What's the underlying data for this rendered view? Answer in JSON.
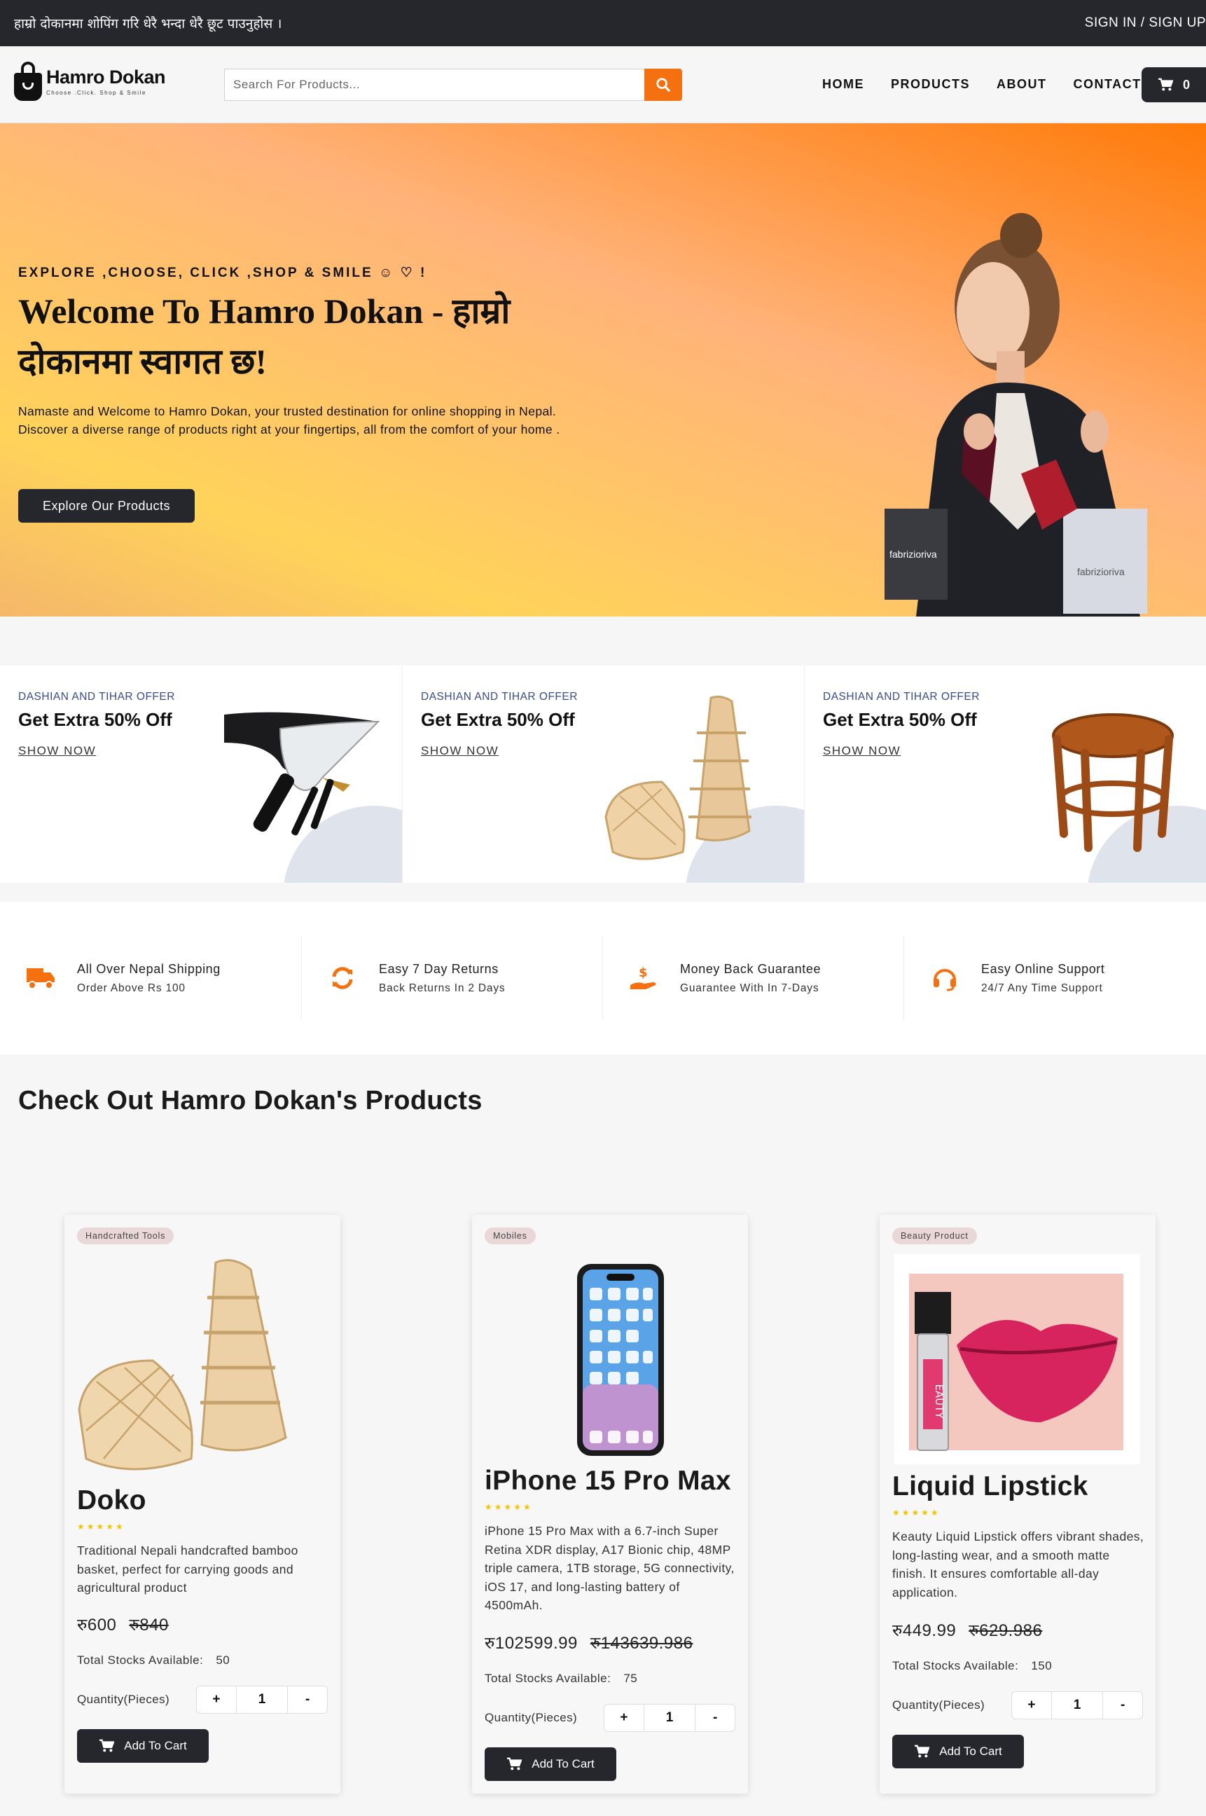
{
  "topbar": {
    "announcement": "हाम्रो दोकानमा शोपिंग गरि धेरै भन्दा धेरै छूट पाउनुहोस ।",
    "auth": "SIGN IN / SIGN UP"
  },
  "logo": {
    "brand": "Hamro Dokan",
    "tagline": "Choose .Click. Shop & Smile"
  },
  "search": {
    "placeholder": "Search For Products..."
  },
  "menu": {
    "home": "HOME",
    "products": "PRODUCTS",
    "about": "ABOUT",
    "contact": "CONTACT"
  },
  "cart": {
    "count": "0"
  },
  "hero": {
    "kicker": "EXPLORE ,CHOOSE, CLICK ,SHOP & SMILE ☺ ♡ !",
    "title": "Welcome To Hamro Dokan - हाम्रो दोकानमा स्वागत छ!",
    "lead": "Namaste and Welcome to Hamro Dokan, your trusted destination for online shopping in Nepal. Discover a diverse range of products right at your fingertips, all from the comfort of your home .",
    "cta": "Explore Our Products",
    "bag_brand": "fabrizioriva"
  },
  "offers": [
    {
      "category": "DASHIAN AND TIHAR OFFER",
      "title": "Get Extra 50% Off",
      "link": "SHOW NOW"
    },
    {
      "category": "DASHIAN AND TIHAR OFFER",
      "title": "Get Extra 50% Off",
      "link": "SHOW NOW"
    },
    {
      "category": "DASHIAN AND TIHAR OFFER",
      "title": "Get Extra 50% Off",
      "link": "SHOW NOW"
    }
  ],
  "features": [
    {
      "icon": "truck-icon",
      "title": "All Over Nepal Shipping",
      "subtitle": "Order Above Rs 100"
    },
    {
      "icon": "refresh-icon",
      "title": "Easy 7 Day Returns",
      "subtitle": "Back Returns In 2 Days"
    },
    {
      "icon": "money-hand-icon",
      "title": "Money Back Guarantee",
      "subtitle": "Guarantee With In 7-Days"
    },
    {
      "icon": "headset-icon",
      "title": "Easy Online Support",
      "subtitle": "24/7 Any Time Support"
    }
  ],
  "section_title": "Check Out Hamro Dokan's Products",
  "products": [
    {
      "badge": "Handcrafted Tools",
      "name": "Doko",
      "stars": "★★★★★",
      "description": "Traditional Nepali handcrafted bamboo basket, perfect for carrying goods and agricultural product",
      "price": "रु600",
      "old_price": "रु840",
      "stock_label": "Total Stocks Available:",
      "stock": "50",
      "qty_label": "Quantity(Pieces)",
      "qty": "1",
      "add_label": "Add To Cart"
    },
    {
      "badge": "Mobiles",
      "name": "iPhone 15 Pro Max",
      "stars": "★★★★★",
      "description": "iPhone 15 Pro Max with a 6.7-inch Super Retina XDR display, A17 Bionic chip, 48MP triple camera, 1TB storage, 5G connectivity, iOS 17, and long-lasting battery of 4500mAh.",
      "price": "रु102599.99",
      "old_price": "रु143639.986",
      "stock_label": "Total Stocks Available:",
      "stock": "75",
      "qty_label": "Quantity(Pieces)",
      "qty": "1",
      "add_label": "Add To Cart"
    },
    {
      "badge": "Beauty Product",
      "name": "Liquid Lipstick",
      "stars": "★★★★★",
      "description": "Keauty Liquid Lipstick offers vibrant shades, long-lasting wear, and a smooth matte finish. It ensures comfortable all-day application.",
      "price": "रु449.99",
      "old_price": "रु629.986",
      "stock_label": "Total Stocks Available:",
      "stock": "150",
      "qty_label": "Quantity(Pieces)",
      "qty": "1",
      "add_label": "Add To Cart",
      "tube_text": "EAUTY"
    }
  ],
  "colors": {
    "accent": "#f5700f",
    "dark": "#25272c",
    "link_blue": "#3a4a8a",
    "star": "#f5c400"
  }
}
